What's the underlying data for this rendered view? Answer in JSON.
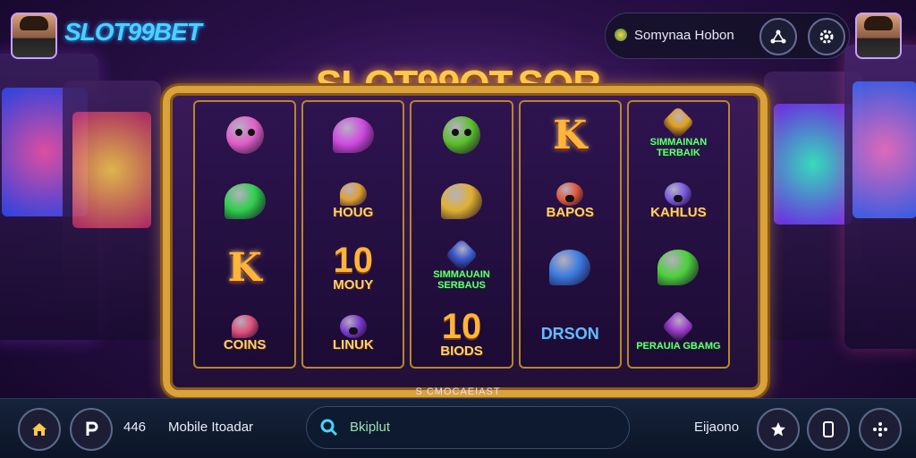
{
  "header": {
    "brand": "SLOT99BET",
    "username": "Somynaa Hobon"
  },
  "reels_title": "SLOT99OT.SOR",
  "reels": [
    [
      {
        "kind": "face",
        "label": "",
        "color": "#e060c8"
      },
      {
        "kind": "blob",
        "label": "",
        "color": "#2ecf4a"
      },
      {
        "kind": "letter",
        "label": "K"
      },
      {
        "kind": "blob",
        "label": "COINS",
        "color": "#e0507a"
      }
    ],
    [
      {
        "kind": "blob",
        "label": "",
        "color": "#d04ae0"
      },
      {
        "kind": "blob",
        "label": "HOUG",
        "color": "#e0a030"
      },
      {
        "kind": "number",
        "value": "10",
        "label": "MOUY"
      },
      {
        "kind": "face",
        "label": "LINUK",
        "color": "#7a3ad0"
      }
    ],
    [
      {
        "kind": "face",
        "label": "",
        "color": "#5ac02a"
      },
      {
        "kind": "blob",
        "label": "",
        "color": "#e0b030"
      },
      {
        "kind": "gem",
        "label": "SIMMAUAIN SERBAUS",
        "color": "#3a5ad0"
      },
      {
        "kind": "number",
        "value": "10",
        "label": "BIODS"
      }
    ],
    [
      {
        "kind": "letter",
        "label": "K"
      },
      {
        "kind": "face",
        "label": "BAPOS",
        "color": "#e05a3a"
      },
      {
        "kind": "blob",
        "label": "",
        "color": "#3a7ae0"
      },
      {
        "kind": "letter",
        "label": "DRSON"
      }
    ],
    [
      {
        "kind": "gem",
        "label": "SIMMAINAN TERBAIK",
        "color": "#e0a020"
      },
      {
        "kind": "face",
        "label": "KAHLUS",
        "color": "#7a5ae0"
      },
      {
        "kind": "blob",
        "label": "",
        "color": "#4ad03a"
      },
      {
        "kind": "gem",
        "label": "PERAUIA GBAMG",
        "color": "#a040d0"
      }
    ]
  ],
  "caption": "S CMOCAEIAST",
  "bottom_bar": {
    "number": "446",
    "label": "Mobile Itoadar",
    "search_value": "Bkiplut",
    "right_label": "Eijaono"
  },
  "icons": {
    "header": [
      "nodes-icon",
      "gear-icon"
    ],
    "bottom": [
      "home-icon",
      "p-icon",
      "star-icon",
      "tablet-icon",
      "network-icon"
    ]
  },
  "colors": {
    "accent_gold": "#ffc94a",
    "brand_blue": "#4ad2ff"
  }
}
